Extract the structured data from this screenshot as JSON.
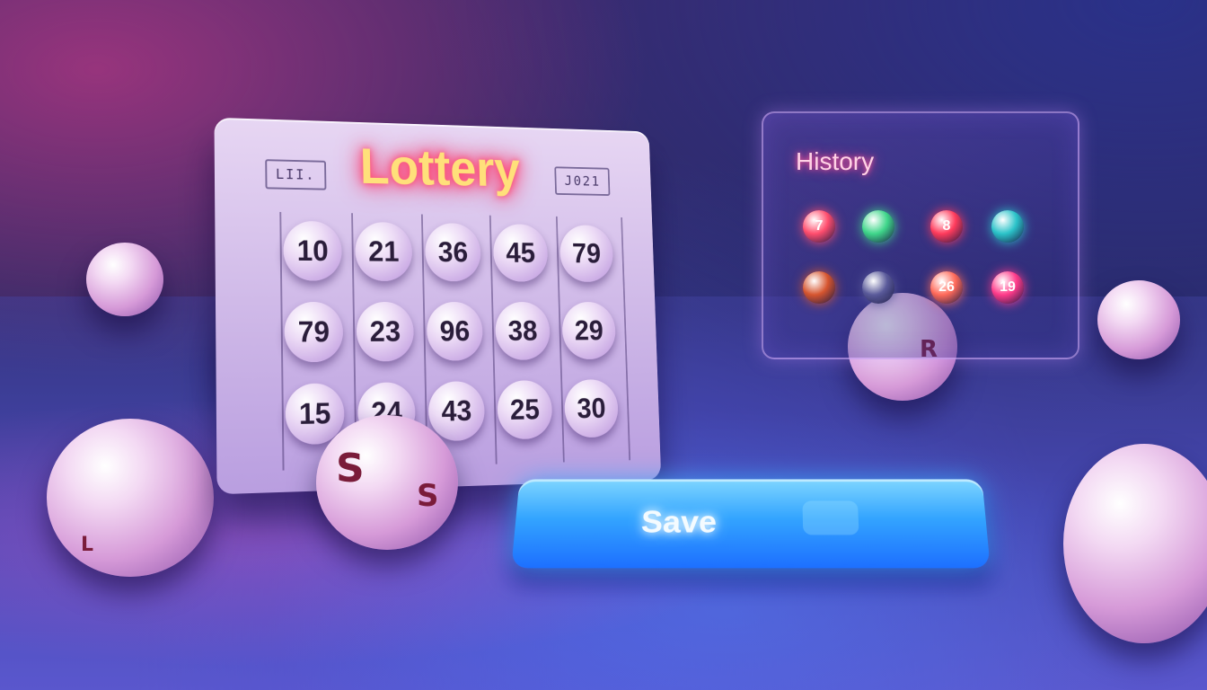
{
  "board": {
    "title": "Lottery",
    "tag_left": "LII.",
    "tag_right": "J021",
    "rows": [
      [
        "10",
        "21",
        "36",
        "45",
        "79"
      ],
      [
        "79",
        "23",
        "96",
        "38",
        "29"
      ],
      [
        "15",
        "24",
        "43",
        "25",
        "30"
      ]
    ]
  },
  "history": {
    "title": "History",
    "items": [
      {
        "label": "7",
        "color": "#ff4d6d"
      },
      {
        "label": "",
        "color": "#3fd68a"
      },
      {
        "label": "8",
        "color": "#ff3b5c"
      },
      {
        "label": "",
        "color": "#2bc3c9"
      },
      {
        "label": "",
        "color": "#d6552f"
      },
      {
        "label": "",
        "color": "#5a5a9a"
      },
      {
        "label": "26",
        "color": "#ff6a5a"
      },
      {
        "label": "19",
        "color": "#ff3b8a"
      }
    ]
  },
  "save_button": {
    "label": "Save"
  },
  "colors": {
    "accent_neon": "#ff3070",
    "button_blue": "#33a4ff"
  }
}
